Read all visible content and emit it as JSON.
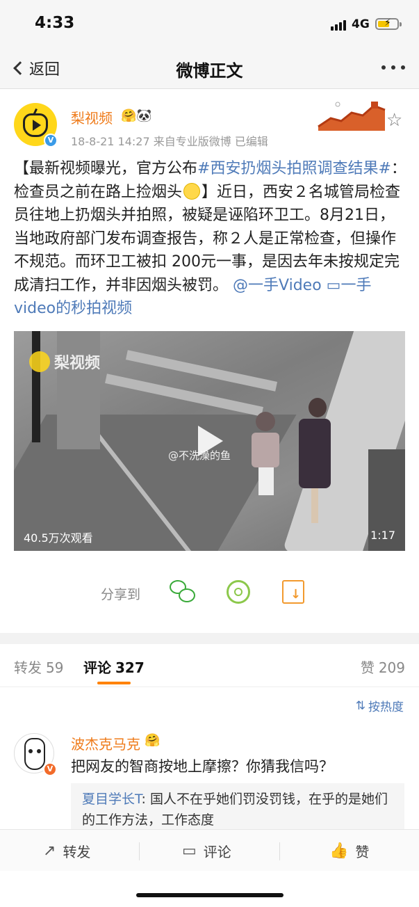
{
  "status_bar": {
    "time": "4:33",
    "network": "4G",
    "colors": {
      "battery": "#f5c400"
    }
  },
  "nav": {
    "back_label": "返回",
    "title": "微博正文"
  },
  "author": {
    "name": "梨视频",
    "badges": "🤗🐼",
    "meta": "18-8-21 14:27  来自专业版微博  已编辑",
    "verified": "V"
  },
  "post": {
    "part1": "【最新视频曝光，官方公布",
    "hashtag": "#西安扔烟头拍照调查结果#",
    "part2": "：检查员之前在路上捡烟头",
    "part3": "】近日，西安２名城管局检查员往地上扔烟头并拍照，被疑是诬陷环卫工。8月21日，当地政府部门发布调查报告，称２人是正常检查，但操作不规范。而环卫工被扣 200元一事，是因去年未按规定完成清扫工作，并非因烟头被罚。",
    "mention": "@一手Video",
    "video_link": "一手video的秒拍视频"
  },
  "video": {
    "logo_text": "梨视频",
    "watermark": "@不洗澡的鱼",
    "views": "40.5万次观看",
    "duration": "1:17"
  },
  "share": {
    "label": "分享到",
    "icons": [
      "wechat-icon",
      "moments-icon",
      "save-image-icon"
    ]
  },
  "tabs": {
    "repost_label": "转发",
    "repost_count": "59",
    "comment_label": "评论",
    "comment_count": "327",
    "like_label": "赞",
    "like_count": "209",
    "accent": "#ff8200"
  },
  "sort": {
    "label": "按热度"
  },
  "comment": {
    "name": "波杰克马克",
    "badge": "🤗",
    "verified": "V",
    "text": "把网友的智商按地上摩擦？你猜我信吗？",
    "reply_name": "夏目学长T",
    "reply_text": ": 国人不在乎她们罚没罚钱，在乎的是她们的工作方法，工作态度"
  },
  "bottom_bar": {
    "repost": "转发",
    "comment": "评论",
    "like": "赞"
  }
}
